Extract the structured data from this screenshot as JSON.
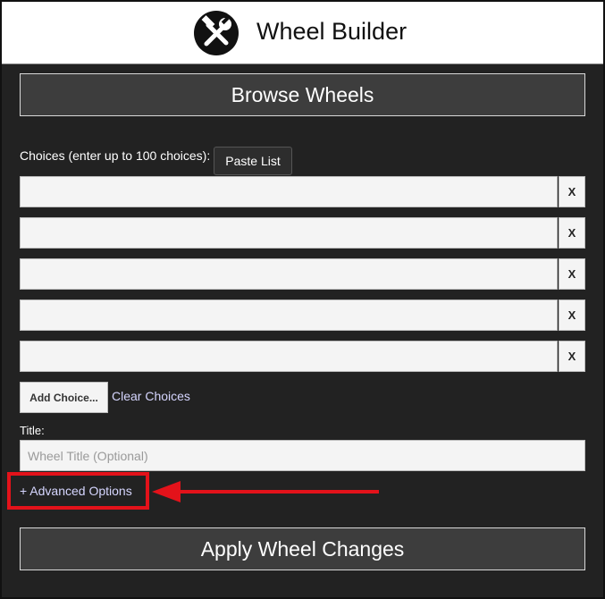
{
  "header": {
    "app_title": "Wheel Builder",
    "logo_icon": "hammer-wrench-icon"
  },
  "browse_button": {
    "label": "Browse Wheels"
  },
  "choices": {
    "label": "Choices (enter up to 100 choices):",
    "paste_label": "Paste List",
    "items": [
      {
        "value": "",
        "remove_label": "X"
      },
      {
        "value": "",
        "remove_label": "X"
      },
      {
        "value": "",
        "remove_label": "X"
      },
      {
        "value": "",
        "remove_label": "X"
      },
      {
        "value": "",
        "remove_label": "X"
      }
    ],
    "add_label": "Add Choice...",
    "clear_label": "Clear Choices"
  },
  "title_field": {
    "label": "Title:",
    "value": "",
    "placeholder": "Wheel Title (Optional)"
  },
  "advanced": {
    "label": "+ Advanced Options"
  },
  "apply_button": {
    "label": "Apply Wheel Changes"
  },
  "colors": {
    "panel_bg": "#222222",
    "button_bg": "#3d3d3d",
    "link": "#d6d6ff",
    "annotation": "#e3121a"
  }
}
